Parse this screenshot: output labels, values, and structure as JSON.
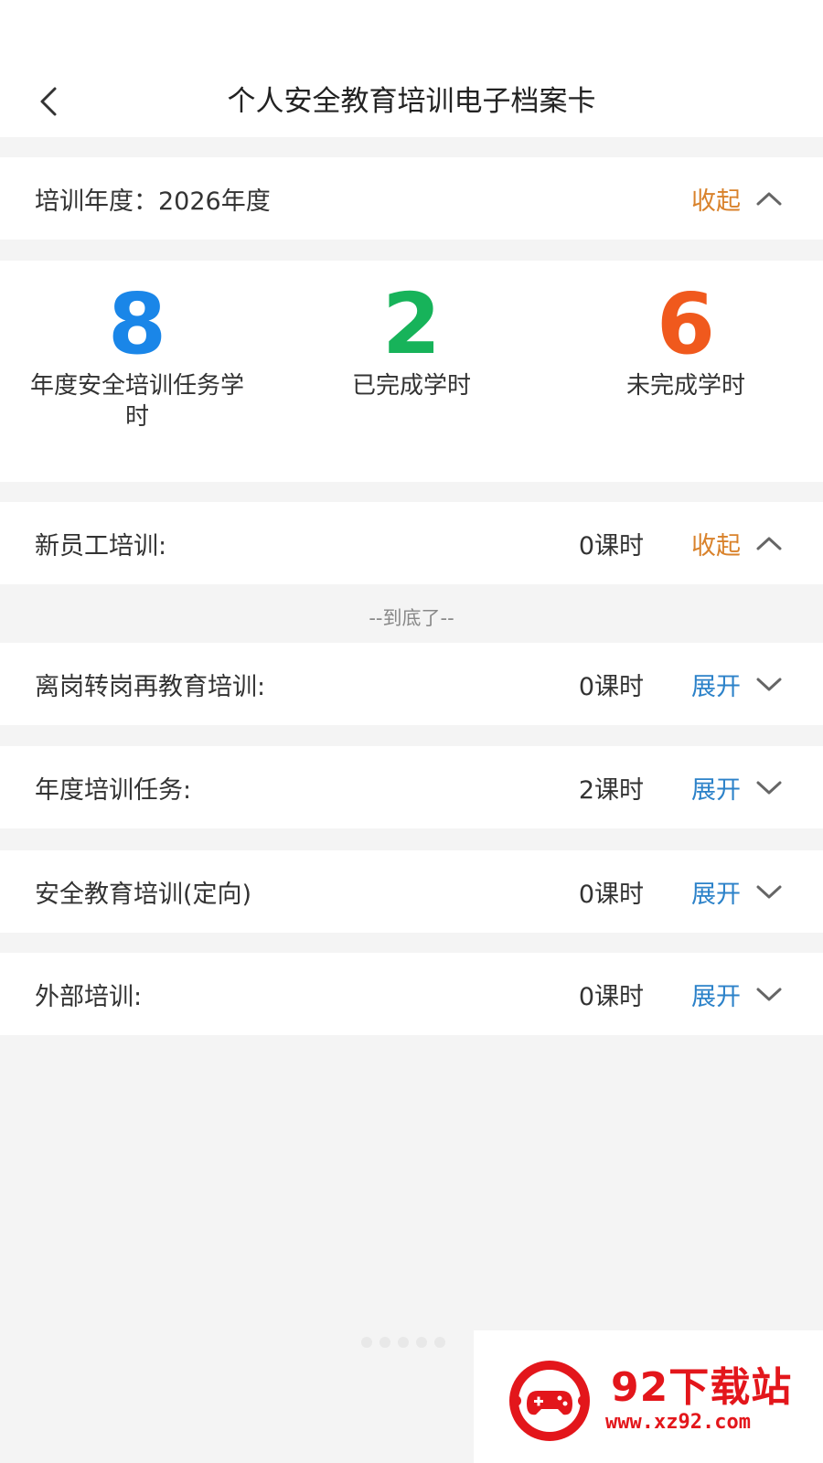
{
  "header": {
    "title": "个人安全教育培训电子档案卡"
  },
  "year_bar": {
    "label": "培训年度：2026年度",
    "toggle": "收起",
    "toggle_color": "#d9822b"
  },
  "stats": [
    {
      "value": "8",
      "label": "年度安全培训任务学时",
      "color": "#1a86e8"
    },
    {
      "value": "2",
      "label": "已完成学时",
      "color": "#17b35a"
    },
    {
      "value": "6",
      "label": "未完成学时",
      "color": "#f0591d"
    }
  ],
  "sections": [
    {
      "label": "新员工培训:",
      "hours": "0课时",
      "toggle": "收起",
      "state": "collapse",
      "color": "#d9822b"
    },
    {
      "label": "离岗转岗再教育培训:",
      "hours": "0课时",
      "toggle": "展开",
      "state": "expand",
      "color": "#2c82c9"
    },
    {
      "label": "年度培训任务:",
      "hours": "2课时",
      "toggle": "展开",
      "state": "expand",
      "color": "#2c82c9"
    },
    {
      "label": "安全教育培训(定向)",
      "hours": "0课时",
      "toggle": "展开",
      "state": "expand",
      "color": "#2c82c9"
    },
    {
      "label": "外部培训:",
      "hours": "0课时",
      "toggle": "展开",
      "state": "expand",
      "color": "#2c82c9"
    }
  ],
  "end_text": "--到底了--",
  "watermark": {
    "name": "92下载站",
    "url": "www.xz92.com"
  }
}
